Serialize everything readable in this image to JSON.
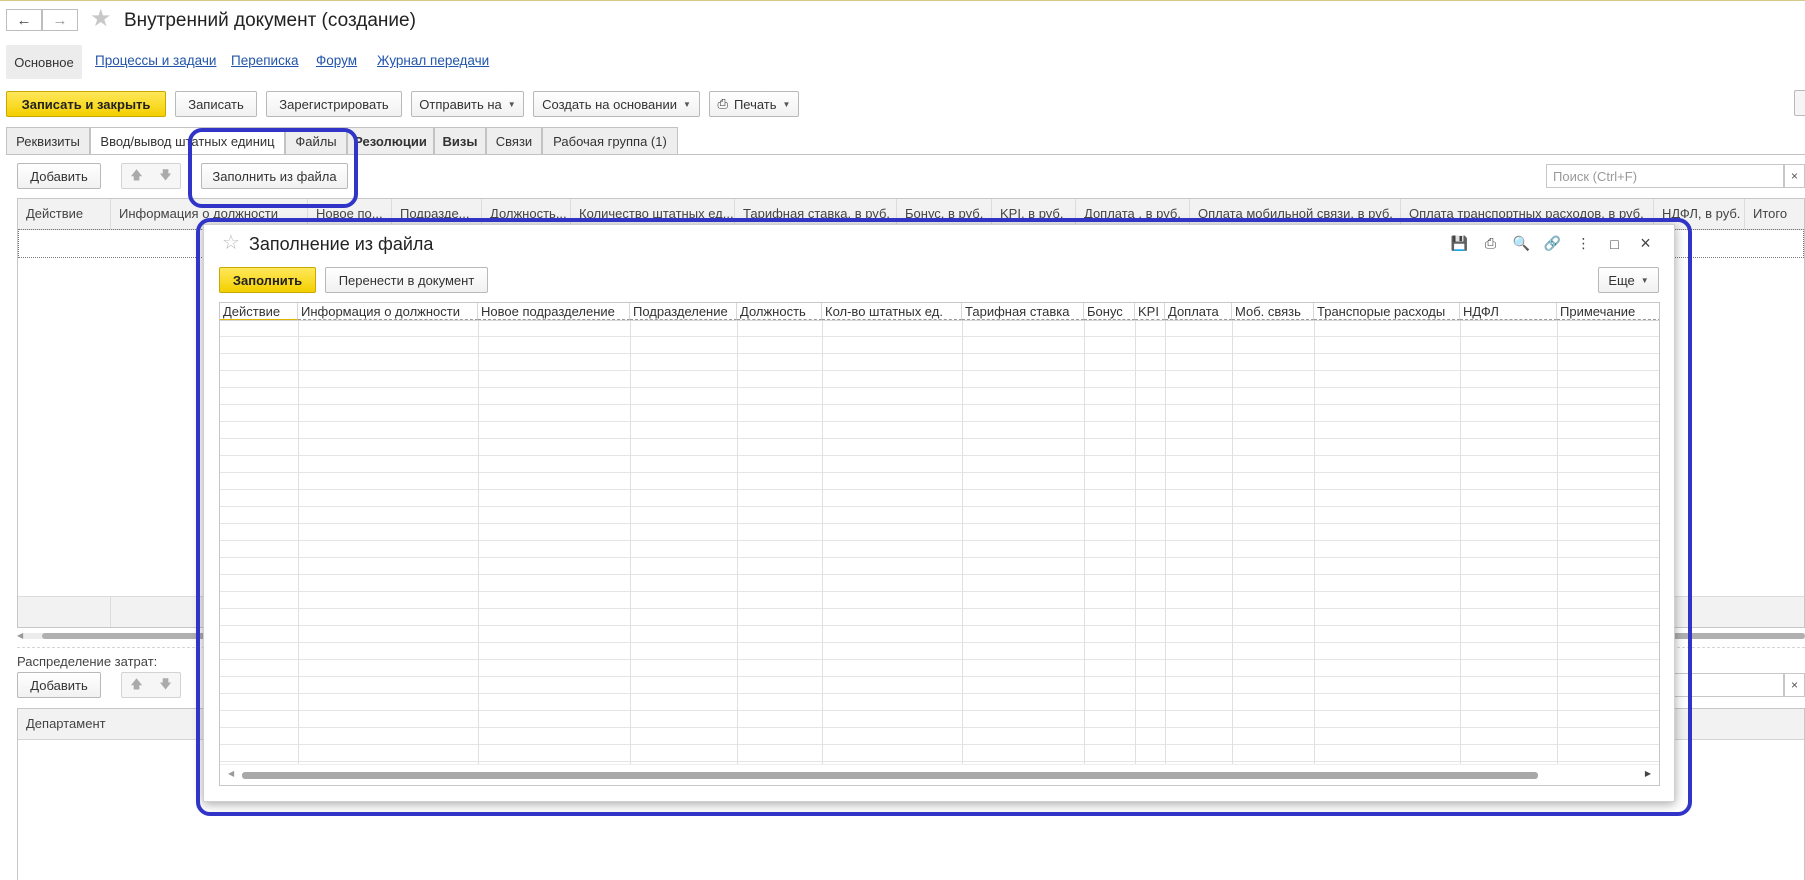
{
  "header": {
    "back_icon": "arrow-left-icon",
    "forward_icon": "arrow-right-icon",
    "favorite_icon": "star-icon",
    "title": "Внутренний документ (создание)"
  },
  "sections": {
    "active": "Основное",
    "links": [
      "Процессы и задачи",
      "Переписка",
      "Форум",
      "Журнал передачи"
    ]
  },
  "toolbar": {
    "save_close": "Записать и закрыть",
    "save": "Записать",
    "register": "Зарегистрировать",
    "send_to": "Отправить на",
    "create_based": "Создать на основании",
    "print": "Печать",
    "print_icon": "printer-icon"
  },
  "tabs": [
    {
      "label": "Реквизиты",
      "active": false,
      "bold": false
    },
    {
      "label": "Ввод/вывод штатных единиц",
      "active": true,
      "bold": false
    },
    {
      "label": "Файлы",
      "active": false,
      "bold": false
    },
    {
      "label": "Резолюции",
      "active": false,
      "bold": true
    },
    {
      "label": "Визы",
      "active": false,
      "bold": true
    },
    {
      "label": "Связи",
      "active": false,
      "bold": false
    },
    {
      "label": "Рабочая группа (1)",
      "active": false,
      "bold": false
    }
  ],
  "grid_toolbar": {
    "add": "Добавить",
    "fill_from_file": "Заполнить из файла",
    "search_placeholder": "Поиск (Ctrl+F)",
    "clear": "×"
  },
  "main_grid": {
    "columns": [
      "Действие",
      "Информация о должности",
      "Новое по...",
      "Подразде...",
      "Должность...",
      "Количество штатных ед...",
      "Тарифная ставка, в руб.",
      "Бонус, в руб.",
      "KPI, в руб.",
      "Доплата , в руб.",
      "Оплата мобильной связи, в руб.",
      "Оплата транспортных расходов, в руб.",
      "НДФЛ, в руб.",
      "Итого"
    ]
  },
  "cost_section": {
    "label": "Распределение затрат:",
    "add": "Добавить",
    "clear": "×",
    "columns": [
      "Департамент"
    ]
  },
  "modal": {
    "title": "Заполнение из файла",
    "fill": "Заполнить",
    "move_to_doc": "Перенести в документ",
    "more": "Еще",
    "icons": [
      "save-icon",
      "print-icon",
      "preview-icon",
      "link-icon",
      "more-icon",
      "maximize-icon",
      "close-icon"
    ],
    "columns": [
      "Действие",
      "Информация о должности",
      "Новое подразделение",
      "Подразделение",
      "Должность",
      "Кол-во штатных ед.",
      "Тарифная ставка",
      "Бонус",
      "KPI",
      "Доплата",
      "Моб. связь",
      "Транспорые расходы",
      "НДФЛ",
      "Примечание"
    ]
  }
}
